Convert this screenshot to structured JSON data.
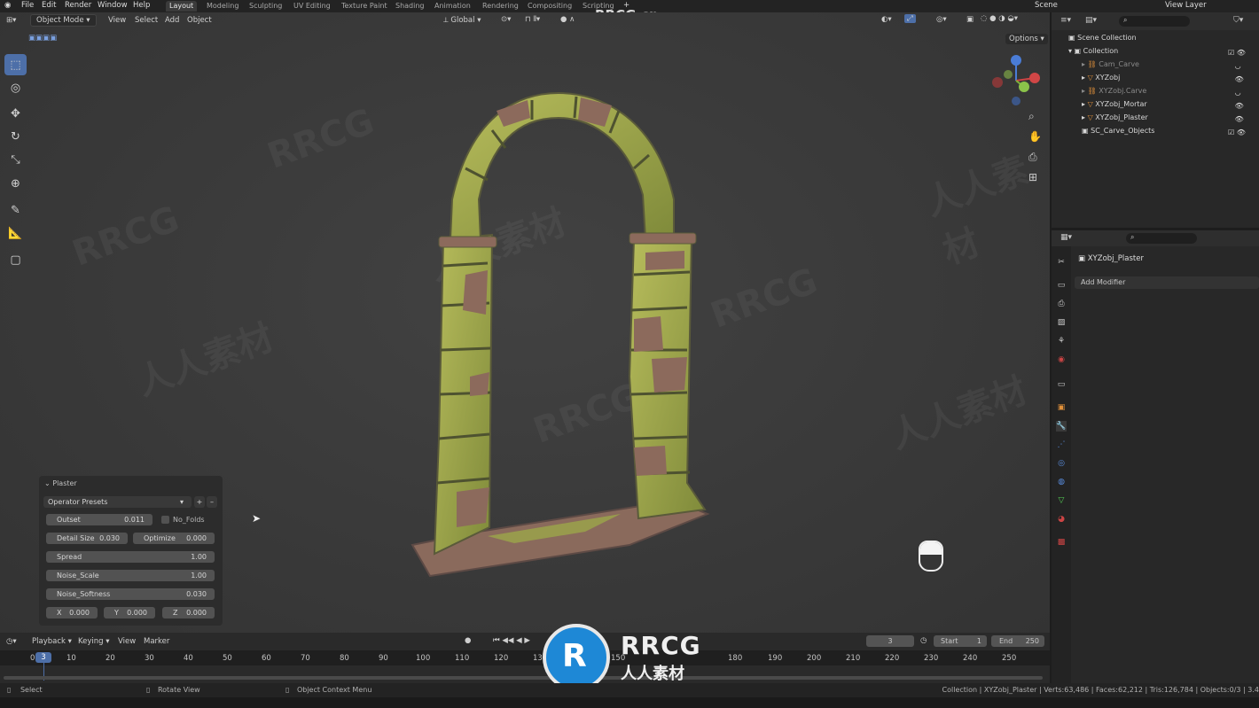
{
  "topbar": {
    "menus": [
      "File",
      "Edit",
      "Render",
      "Window",
      "Help"
    ],
    "workspaces": [
      "Layout",
      "Modeling",
      "Sculpting",
      "UV Editing",
      "Texture Paint",
      "Shading",
      "Animation",
      "Rendering",
      "Compositing",
      "Scripting"
    ],
    "active_workspace": "Layout",
    "scene": "Scene",
    "view_layer": "View Layer",
    "watermark_text": "RRCG.cn"
  },
  "viewport_header": {
    "mode": "Object Mode",
    "menus": [
      "View",
      "Select",
      "Add",
      "Object"
    ],
    "orientation": "Global",
    "options_label": "Options"
  },
  "outliner": {
    "root": "Scene Collection",
    "collection": "Collection",
    "items": [
      "Cam_Carve",
      "XYZobj",
      "XYZobj.Carve",
      "XYZobj_Mortar",
      "XYZobj_Plaster"
    ],
    "sc_collection": "SC_Carve_Objects"
  },
  "properties": {
    "object_name": "XYZobj_Plaster",
    "add_modifier": "Add Modifier"
  },
  "operator_panel": {
    "title": "Plaster",
    "presets": "Operator Presets",
    "outset_label": "Outset",
    "outset_value": "0.011",
    "no_folds_label": "No_Folds",
    "detail_size_label": "Detail Size",
    "detail_size_value": "0.030",
    "optimize_label": "Optimize",
    "optimize_value": "0.000",
    "spread_label": "Spread",
    "spread_value": "1.00",
    "noise_scale_label": "Noise_Scale",
    "noise_scale_value": "1.00",
    "noise_softness_label": "Noise_Softness",
    "noise_softness_value": "0.030",
    "x_label": "X",
    "x_value": "0.000",
    "y_label": "Y",
    "y_value": "0.000",
    "z_label": "Z",
    "z_value": "0.000"
  },
  "timeline": {
    "menus": [
      "Playback",
      "Keying",
      "View",
      "Marker"
    ],
    "current_frame": "3",
    "start_label": "Start",
    "start_value": "1",
    "end_label": "End",
    "end_value": "250",
    "ticks": [
      "0",
      "10",
      "20",
      "30",
      "40",
      "50",
      "60",
      "70",
      "80",
      "90",
      "100",
      "110",
      "120",
      "130",
      "150",
      "180",
      "190",
      "200",
      "210",
      "220",
      "230",
      "240",
      "250"
    ],
    "cursor_value": "3"
  },
  "statusbar": {
    "select": "Select",
    "rotate": "Rotate View",
    "context": "Object Context Menu",
    "stats": "Collection | XYZobj_Plaster | Verts:63,486 | Faces:62,212 | Tris:126,784 | Objects:0/3 | 3.4"
  },
  "logo": {
    "brand": "RRCG",
    "subtitle": "人人素材"
  },
  "colors": {
    "accent": "#4d6fa8",
    "stone": "#9aa24a",
    "brick": "#8c6a5c"
  }
}
